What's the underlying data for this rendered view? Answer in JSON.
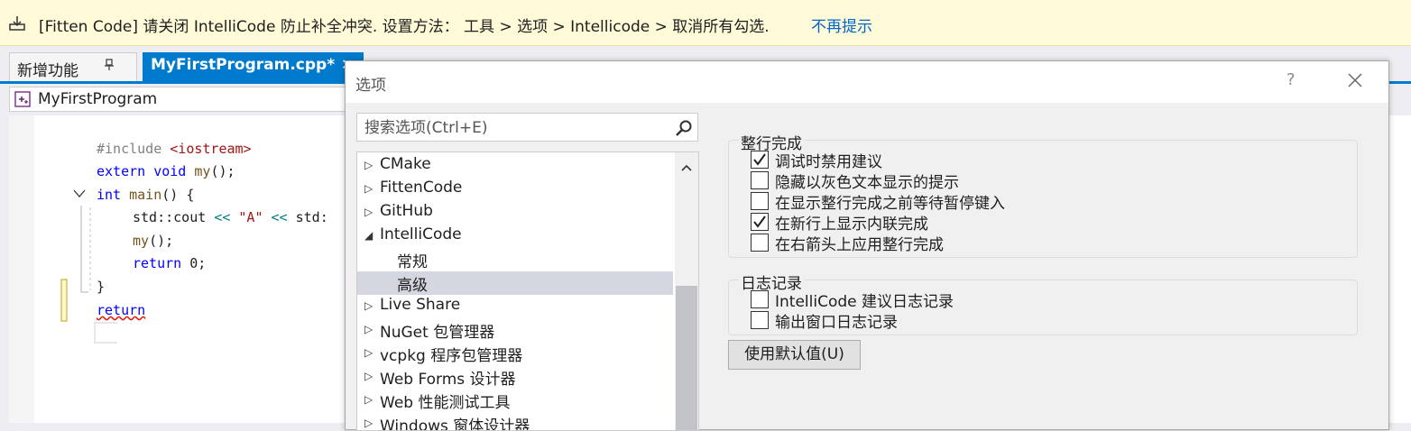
{
  "infobar": {
    "message": "[Fitten Code] 请关闭 IntelliCode 防止补全冲突. 设置方法： 工具 > 选项 > Intellicode > 取消所有勾选.",
    "link": "不再提示",
    "icon": "download-icon"
  },
  "tabs": {
    "tab1_label": "新增功能",
    "tab1_pin": "ꟸ",
    "tab2_label": "MyFirstProgram.cpp*",
    "tab2_close": "✕"
  },
  "navbar": {
    "project": "MyFirstProgram"
  },
  "code": {
    "line1_pp": "#include ",
    "line1_inc": "<iostream>",
    "line2_kw1": "extern",
    "line2_kw2": "void",
    "line2_fn": "my",
    "line2_rest": "();",
    "line3_kw": "int",
    "line3_fn": "main",
    "line3_rest": "() {",
    "line4_a": "std::cout ",
    "line4_op1": "<<",
    "line4_str": "\"A\"",
    "line4_op2": "<<",
    "line4_b": "std:",
    "line5_fn": "my",
    "line5_rest": "();",
    "line6_kw": "return",
    "line6_rest": "0;",
    "line7": "}",
    "line8_err": "return"
  },
  "dialog": {
    "title": "选项",
    "help": "?",
    "search_placeholder": "搜索选项(Ctrl+E)",
    "tree": [
      {
        "label": "CMake",
        "expanded": false
      },
      {
        "label": "FittenCode",
        "expanded": false
      },
      {
        "label": "GitHub",
        "expanded": false
      },
      {
        "label": "IntelliCode",
        "expanded": true
      },
      {
        "label": "常规",
        "child": true
      },
      {
        "label": "高级",
        "child": true,
        "selected": true
      },
      {
        "label": "Live Share",
        "expanded": false
      },
      {
        "label": "NuGet 包管理器",
        "expanded": false
      },
      {
        "label": "vcpkg 程序包管理器",
        "expanded": false
      },
      {
        "label": "Web Forms 设计器",
        "expanded": false
      },
      {
        "label": "Web 性能测试工具",
        "expanded": false
      },
      {
        "label": "Windows 窗体设计器",
        "expanded": false
      }
    ],
    "group1": {
      "title": "整行完成",
      "options": [
        {
          "label": "调试时禁用建议",
          "checked": true
        },
        {
          "label": "隐藏以灰色文本显示的提示",
          "checked": false
        },
        {
          "label": "在显示整行完成之前等待暂停键入",
          "checked": false
        },
        {
          "label": "在新行上显示内联完成",
          "checked": true
        },
        {
          "label": "在右箭头上应用整行完成",
          "checked": false
        }
      ]
    },
    "group2": {
      "title": "日志记录",
      "options": [
        {
          "label": "IntelliCode 建议日志记录",
          "checked": false
        },
        {
          "label": "输出窗口日志记录",
          "checked": false
        }
      ]
    },
    "default_button": "使用默认值(U)"
  }
}
